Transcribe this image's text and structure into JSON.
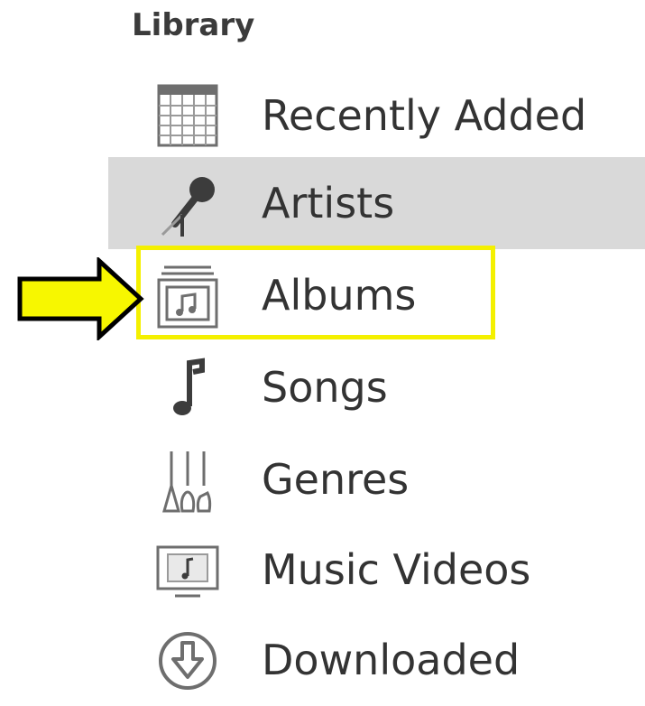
{
  "library": {
    "title": "Library",
    "items": [
      {
        "label": "Recently Added",
        "icon": "calendar-grid-icon"
      },
      {
        "label": "Artists",
        "icon": "microphone-icon"
      },
      {
        "label": "Albums",
        "icon": "album-stack-icon"
      },
      {
        "label": "Songs",
        "icon": "music-note-icon"
      },
      {
        "label": "Genres",
        "icon": "guitars-icon"
      },
      {
        "label": "Music Videos",
        "icon": "music-video-icon"
      },
      {
        "label": "Downloaded",
        "icon": "download-circle-icon"
      }
    ],
    "selected_item": "Artists",
    "highlighted_item": "Albums"
  },
  "colors": {
    "selection_bg": "#d9d9d9",
    "highlight_border": "#f4f000",
    "arrow_fill": "#f7f700",
    "arrow_stroke": "#000000",
    "icon_gray": "#6e6e6e",
    "text": "#333333"
  }
}
